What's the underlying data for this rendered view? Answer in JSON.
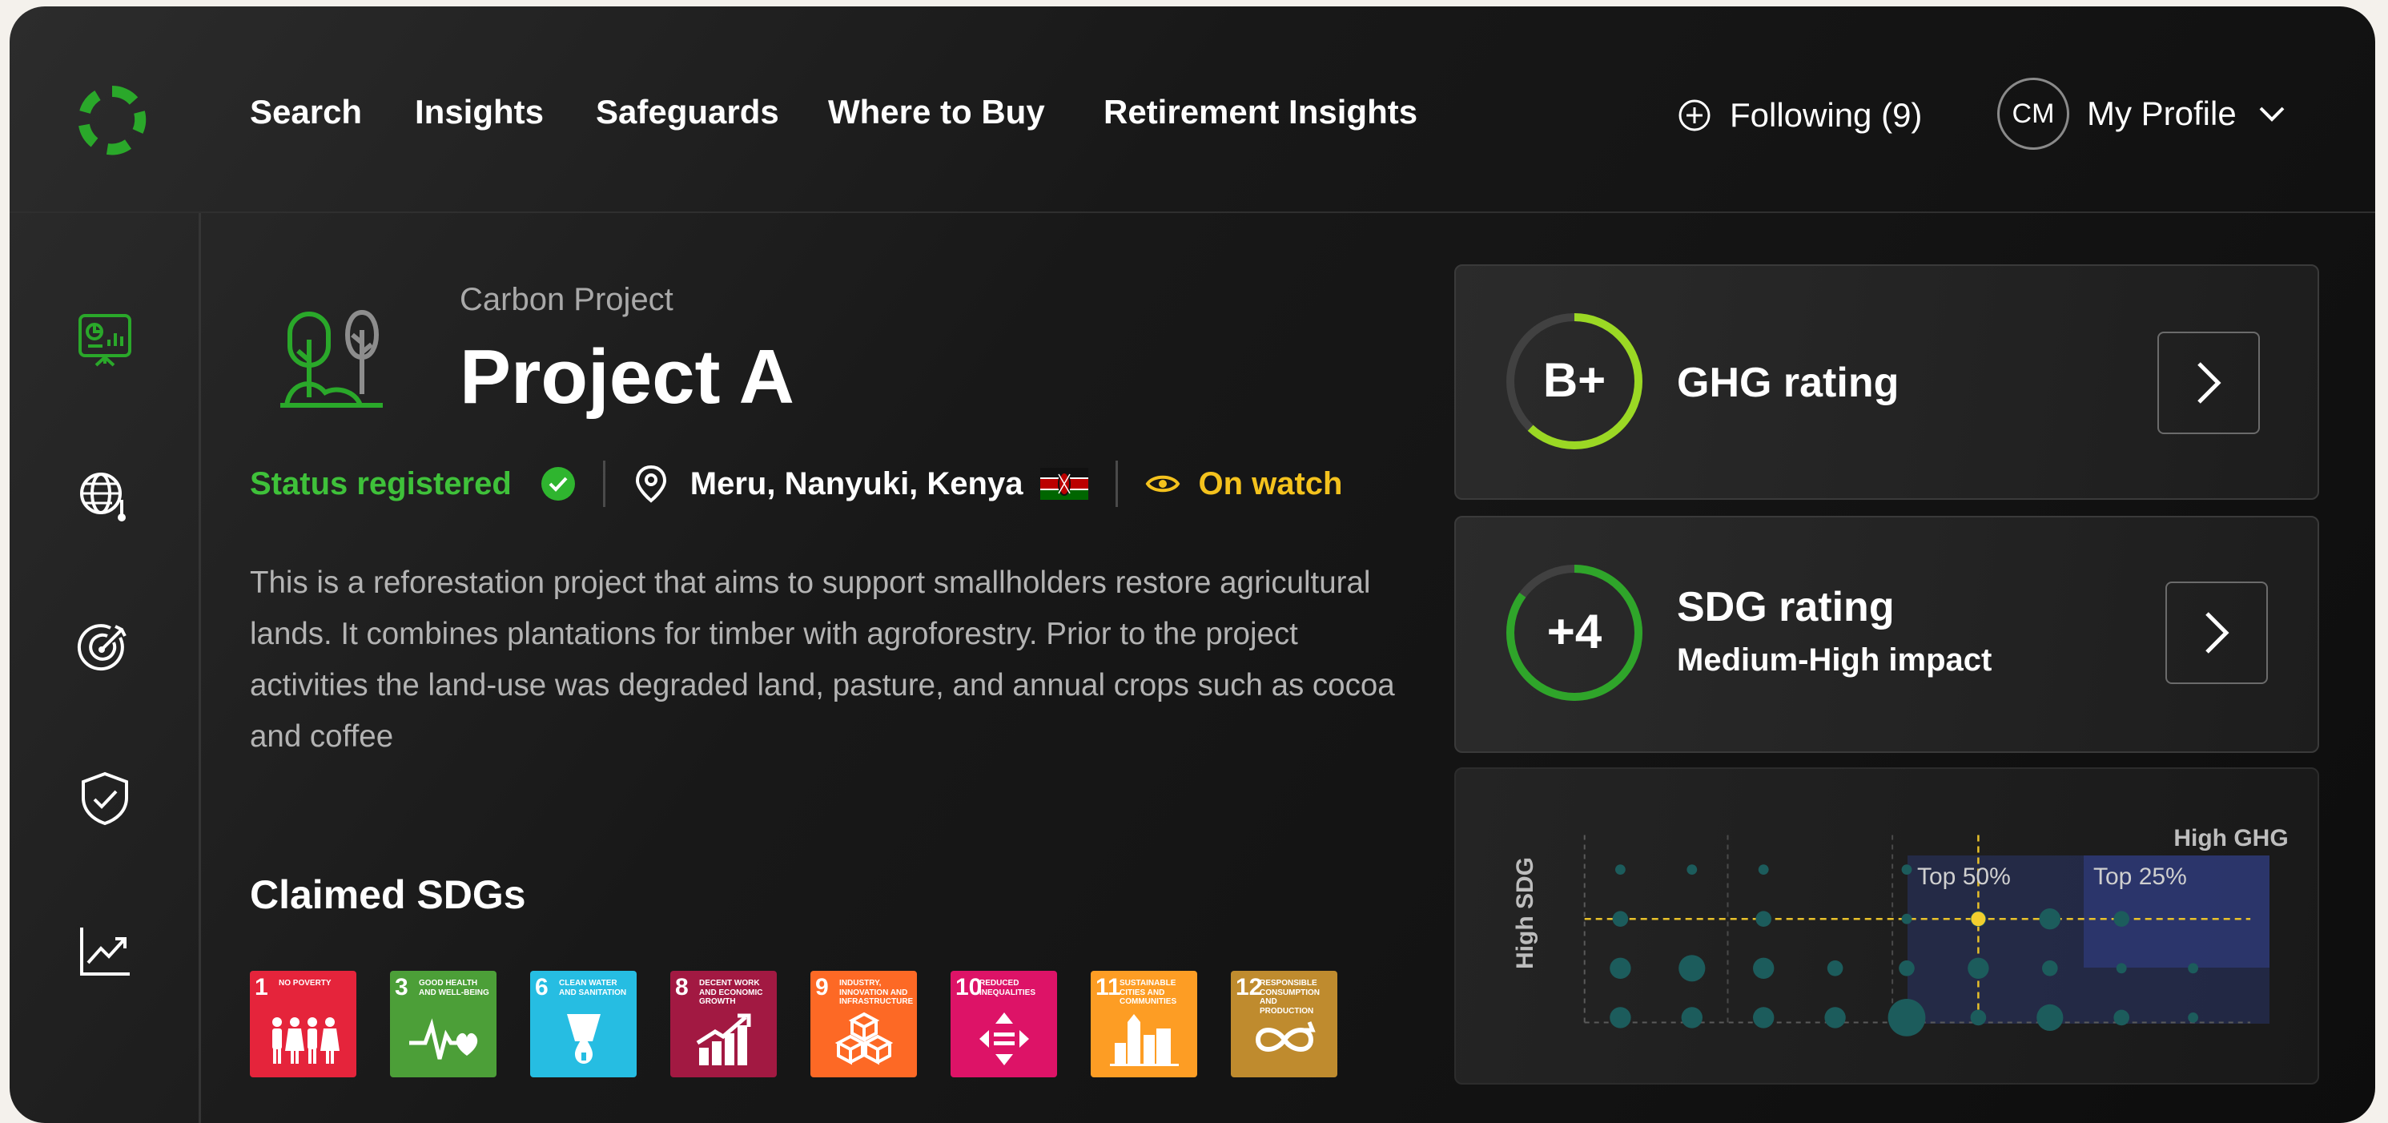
{
  "nav": {
    "links": [
      "Search",
      "Insights",
      "Safeguards",
      "Where to Buy",
      "Retirement Insights"
    ],
    "following_label": "Following (9)",
    "avatar_initials": "CM",
    "profile_label": "My Profile"
  },
  "sidebar": {
    "items": [
      "dashboard-presentation-icon",
      "globe-climate-icon",
      "target-icon",
      "shield-check-icon",
      "trend-chart-icon"
    ],
    "active_index": 0
  },
  "project": {
    "kicker": "Carbon Project",
    "title": "Project A",
    "status": "Status registered",
    "location": "Meru, Nanyuki, Kenya",
    "watch": "On watch",
    "description": "This is a reforestation project that aims to support smallholders restore agricultural lands. It combines plantations for timber with agroforestry. Prior to the project activities the land-use was degraded land, pasture, and annual crops such as cocoa and coffee"
  },
  "sdgs": {
    "heading": "Claimed SDGs",
    "tiles": [
      {
        "num": "1",
        "label": "No Poverty",
        "color": "#e5243b",
        "icon": "people-icon"
      },
      {
        "num": "3",
        "label": "Good Health and Well-Being",
        "color": "#4c9f38",
        "icon": "heartbeat-icon"
      },
      {
        "num": "6",
        "label": "Clean Water and Sanitation",
        "color": "#26bde2",
        "icon": "water-drop-icon"
      },
      {
        "num": "8",
        "label": "Decent Work and Economic Growth",
        "color": "#a21942",
        "icon": "growth-chart-icon"
      },
      {
        "num": "9",
        "label": "Industry, Innovation and Infrastructure",
        "color": "#fd6925",
        "icon": "cubes-icon"
      },
      {
        "num": "10",
        "label": "Reduced Inequalities",
        "color": "#dd1367",
        "icon": "equality-arrows-icon"
      },
      {
        "num": "11",
        "label": "Sustainable Cities and Communities",
        "color": "#fd9d24",
        "icon": "city-icon"
      },
      {
        "num": "12",
        "label": "Responsible Consumption and Production",
        "color": "#bf8b2e",
        "icon": "infinity-icon"
      }
    ]
  },
  "ghg": {
    "grade": "B+",
    "title": "GHG rating",
    "fill": 0.62,
    "color": "#9bd824"
  },
  "sdg_rating": {
    "score": "+4",
    "title": "SDG rating",
    "subtitle": "Medium-High impact",
    "fill": 0.85,
    "color": "#2fa52a"
  },
  "chart_data": {
    "type": "scatter",
    "xlabel": "High GHG",
    "ylabel": "High SDG",
    "regions": [
      "Top 50%",
      "Top 25%"
    ],
    "points": [
      {
        "x": 1,
        "y": 4,
        "s": 1
      },
      {
        "x": 2,
        "y": 4,
        "s": 1
      },
      {
        "x": 3,
        "y": 4,
        "s": 1
      },
      {
        "x": 5,
        "y": 4,
        "s": 1
      },
      {
        "x": 1,
        "y": 3,
        "s": 2
      },
      {
        "x": 3,
        "y": 3,
        "s": 2
      },
      {
        "x": 5,
        "y": 3,
        "s": 1
      },
      {
        "x": 6,
        "y": 3,
        "s": 2
      },
      {
        "x": 7,
        "y": 3,
        "s": 3
      },
      {
        "x": 8,
        "y": 3,
        "s": 2
      },
      {
        "x": 1,
        "y": 2,
        "s": 3
      },
      {
        "x": 2,
        "y": 2,
        "s": 4
      },
      {
        "x": 3,
        "y": 2,
        "s": 3
      },
      {
        "x": 4,
        "y": 2,
        "s": 2
      },
      {
        "x": 5,
        "y": 2,
        "s": 2
      },
      {
        "x": 6,
        "y": 2,
        "s": 3
      },
      {
        "x": 7,
        "y": 2,
        "s": 2
      },
      {
        "x": 8,
        "y": 2,
        "s": 1
      },
      {
        "x": 9,
        "y": 2,
        "s": 1
      },
      {
        "x": 1,
        "y": 1,
        "s": 3
      },
      {
        "x": 2,
        "y": 1,
        "s": 3
      },
      {
        "x": 3,
        "y": 1,
        "s": 3
      },
      {
        "x": 4,
        "y": 1,
        "s": 3
      },
      {
        "x": 5,
        "y": 1,
        "s": 6
      },
      {
        "x": 6,
        "y": 1,
        "s": 2
      },
      {
        "x": 7,
        "y": 1,
        "s": 4
      },
      {
        "x": 8,
        "y": 1,
        "s": 2
      },
      {
        "x": 9,
        "y": 1,
        "s": 1
      }
    ],
    "highlight": {
      "x": 6,
      "y": 3
    },
    "xlim": [
      0,
      10
    ],
    "ylim": [
      0,
      5
    ]
  }
}
